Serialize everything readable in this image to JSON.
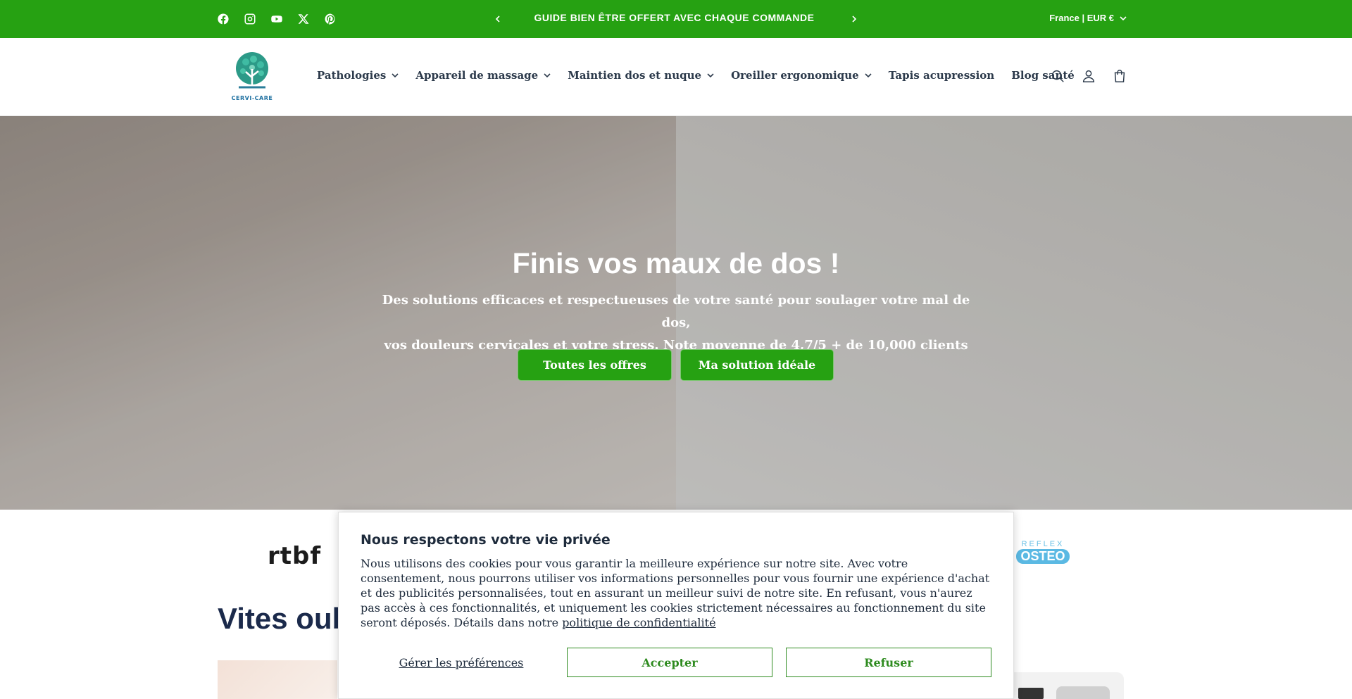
{
  "announcement": {
    "text": "GUIDE BIEN ÊTRE OFFERT AVEC CHAQUE COMMANDE",
    "locale": "France | EUR €",
    "social_icons": [
      "facebook-icon",
      "instagram-icon",
      "youtube-icon",
      "x-icon",
      "pinterest-icon"
    ]
  },
  "brand": {
    "logo_text": "CERVI-CARE",
    "colors": {
      "accent": "#26a112",
      "text": "#2c3a4b"
    }
  },
  "nav": {
    "items": [
      {
        "label": "Pathologies",
        "dropdown": true
      },
      {
        "label": "Appareil de massage",
        "dropdown": true
      },
      {
        "label": "Maintien dos et nuque",
        "dropdown": true
      },
      {
        "label": "Oreiller ergonomique",
        "dropdown": true
      },
      {
        "label": "Tapis acupression",
        "dropdown": false
      },
      {
        "label": "Blog santé",
        "dropdown": false
      }
    ]
  },
  "hero": {
    "title": "Finis vos maux de dos !",
    "subtitle_line1": "Des solutions efficaces et respectueuses de votre santé pour soulager votre mal de dos,",
    "subtitle_line2": "vos douleurs cervicales et votre stress. Note moyenne de 4,7/5     + de 10,000 clients",
    "button_offers": "Toutes les offres",
    "button_solution": "Ma solution idéale"
  },
  "press": {
    "rtbf": "rtbf",
    "reflex": "REFLEX",
    "osteo": "OSTEO"
  },
  "section": {
    "title_partial": "Vites oub"
  },
  "cookie": {
    "title": "Nous respectons votre vie privée",
    "body": "Nous utilisons des cookies pour vous garantir la meilleure expérience sur notre site. Avec votre consentement, nous pourrons utiliser vos informations personnelles pour vous fournir une expérience d'achat et des publicités personnalisées, tout en assurant un meilleur suivi de notre site. En refusant, vous n'aurez pas accès à ces fonctionnalités, et uniquement les cookies strictement nécessaires au fonctionnement du site seront déposés. Détails dans notre",
    "policy_link": "politique de confidentialité",
    "manage": "Gérer les préférences",
    "accept": "Accepter",
    "refuse": "Refuser"
  }
}
